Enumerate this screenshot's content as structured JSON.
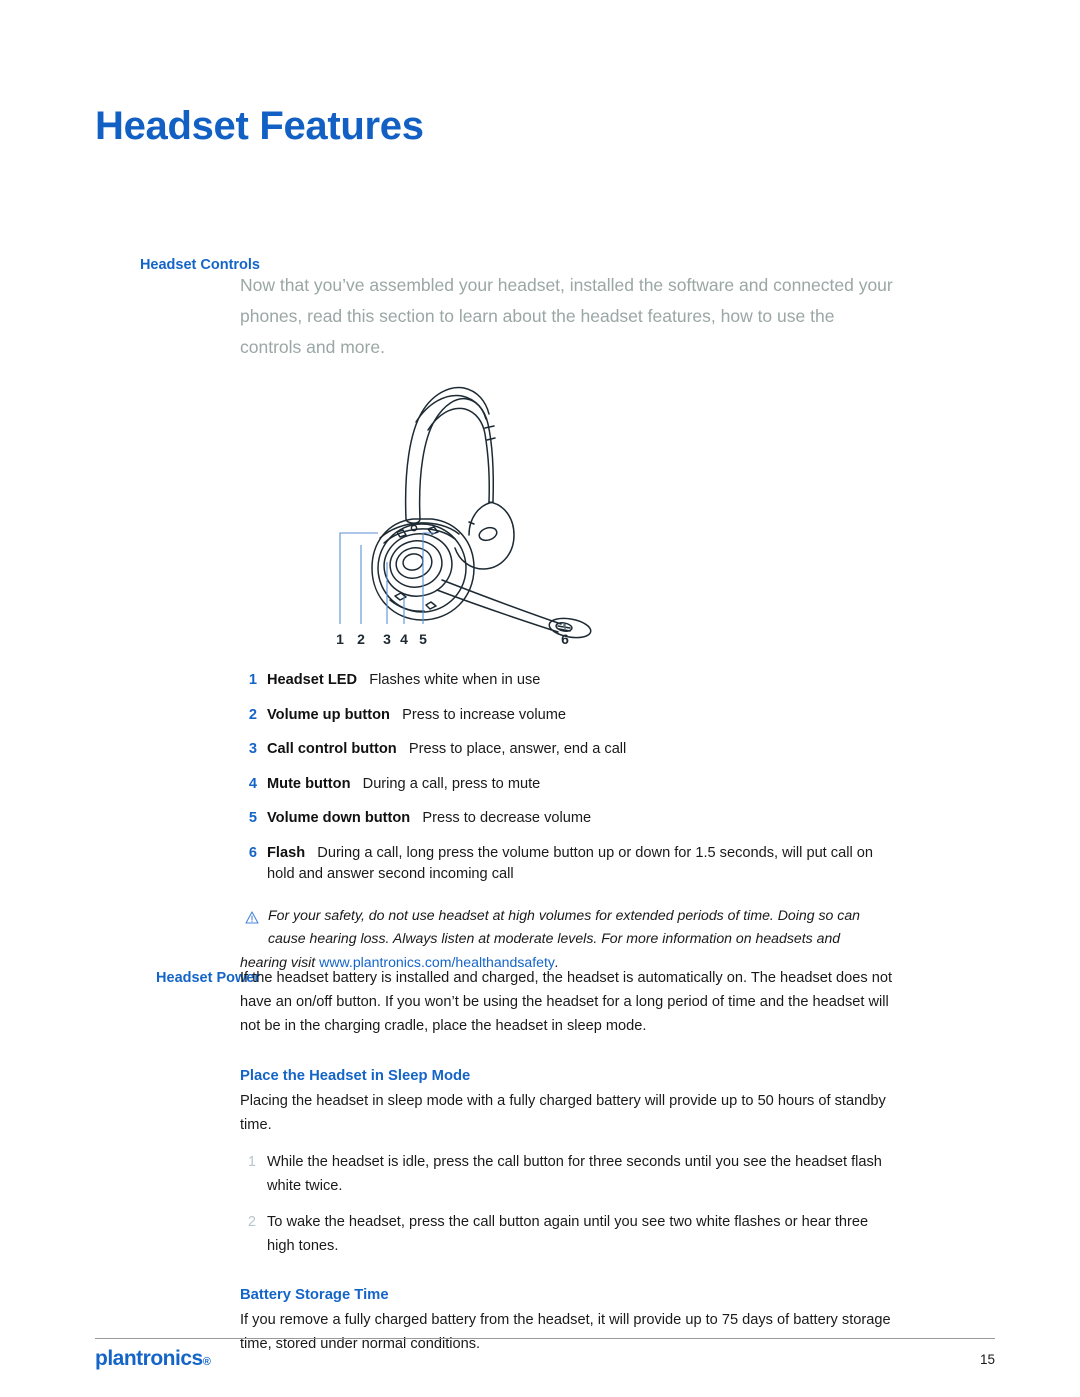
{
  "document": {
    "title": "Headset Features",
    "page_number": "15",
    "brand": "plantronics",
    "brand_mark": "®"
  },
  "headset_controls": {
    "label": "Headset Controls",
    "intro": "Now that you’ve assembled your headset, installed the software and connected your phones, read this section to learn about the headset features, how to use the controls and more.",
    "figure": {
      "name": "headset-illustration",
      "callouts": [
        "1",
        "2",
        "3",
        "4",
        "5",
        "6"
      ]
    },
    "features": [
      {
        "num": "1",
        "term": "Headset LED",
        "desc": "Flashes white when in use"
      },
      {
        "num": "2",
        "term": "Volume up button",
        "desc": "Press to increase volume"
      },
      {
        "num": "3",
        "term": "Call control button",
        "desc": "Press to place, answer, end a call"
      },
      {
        "num": "4",
        "term": "Mute button",
        "desc": "During a call, press to mute"
      },
      {
        "num": "5",
        "term": "Volume down button",
        "desc": "Press to decrease volume"
      },
      {
        "num": "6",
        "term": "Flash",
        "desc": "During a call, long press the volume button up or down for 1.5 seconds, will put call on hold and answer second incoming call"
      }
    ],
    "note": {
      "icon": "warning-triangle-icon",
      "text_part1": "For your safety, do not use headset at high volumes for extended periods of time. Doing so can cause hearing loss. Always listen at moderate levels. For more information on headsets and",
      "text_part2": "hearing visit",
      "link": "www.plantronics.com/healthandsafety",
      "text_end": "."
    }
  },
  "headset_power": {
    "label": "Headset Power",
    "paragraph": "If the headset battery is installed and charged, the headset is automatically on. The headset does not have an on/off button. If you won’t be using the headset for a long period of time and the headset will not be in the charging cradle, place the headset in sleep mode.",
    "sleep_mode": {
      "heading": "Place the Headset in Sleep Mode",
      "paragraph": "Placing the headset in sleep mode with a fully charged battery will provide up to 50 hours of standby time.",
      "steps": [
        {
          "num": "1",
          "text": "While the headset is idle, press the call button for three seconds until you see the headset flash white twice."
        },
        {
          "num": "2",
          "text": "To wake the headset, press the call button again until you see two white flashes or hear three high tones."
        }
      ]
    },
    "battery_storage": {
      "heading": "Battery Storage Time",
      "paragraph": "If you remove a fully charged battery from the headset, it will provide up to 75 days of battery storage time, stored under normal conditions."
    }
  },
  "colors": {
    "accent_blue": "#1565C8",
    "title_blue": "#1260C4",
    "muted_intro": "#9aa7a4",
    "step_num_gray": "#b9c6cc"
  }
}
